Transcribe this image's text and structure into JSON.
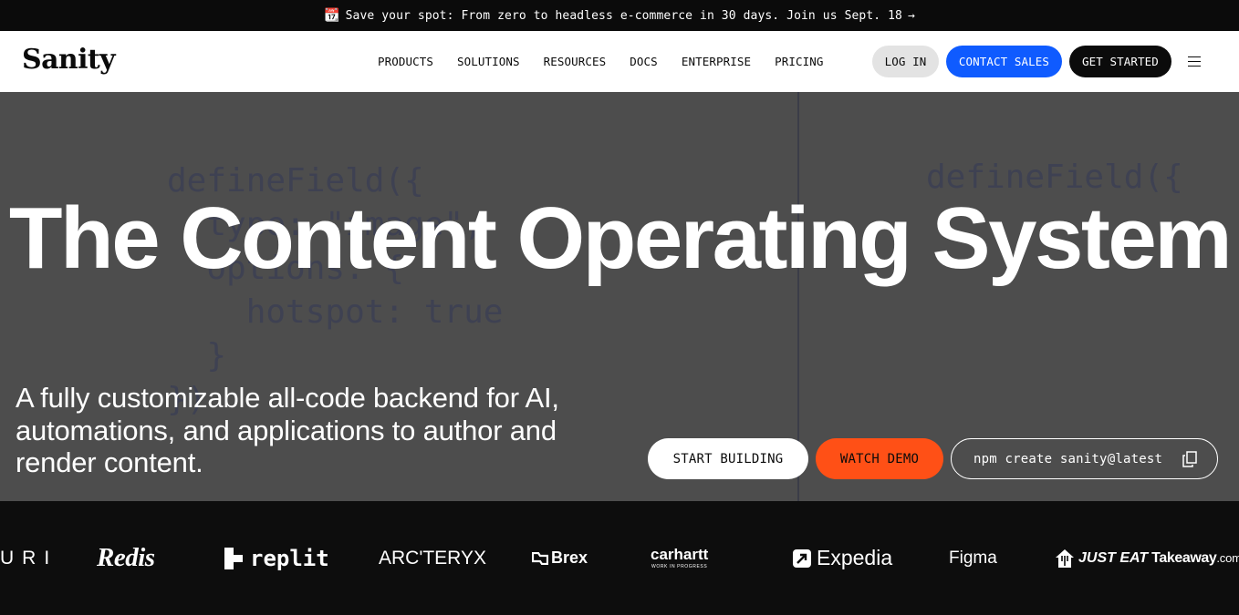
{
  "announcement": {
    "icon": "calendar-icon",
    "text": "Save your spot: From zero to headless e-commerce in 30 days. Join us Sept. 18",
    "arrow": "→"
  },
  "header": {
    "logo": "Sanity",
    "nav": [
      "PRODUCTS",
      "SOLUTIONS",
      "RESOURCES",
      "DOCS",
      "ENTERPRISE",
      "PRICING"
    ],
    "login_label": "LOG IN",
    "contact_label": "CONTACT SALES",
    "get_started_label": "GET STARTED",
    "menu_icon": "hamburger-menu-icon"
  },
  "hero": {
    "code_left": "defineField({\n  type: \"image\",\n  options: {\n    hotspot: true\n  }\n})",
    "code_right": "defineField({",
    "headline": "The Content Operating System",
    "subtitle": "A fully customizable all-code backend for AI, automations, and applications to author and render content.",
    "start_building_label": "START BUILDING",
    "watch_demo_label": "WATCH DEMO",
    "npm_command": "npm create sanity@latest",
    "copy_icon": "copy-icon"
  },
  "logos": [
    {
      "name": "URI"
    },
    {
      "name": "Redis"
    },
    {
      "name": "replit"
    },
    {
      "name": "ARC'TERYX"
    },
    {
      "name": "Brex"
    },
    {
      "name": "carhartt",
      "sub": "WORK IN PROGRESS"
    },
    {
      "name": "Expedia"
    },
    {
      "name": "Figma"
    },
    {
      "name": "JUST EAT",
      "name2": "Takeaway",
      "suffix": ".com"
    }
  ],
  "colors": {
    "hero_bg": "#4d4d4d",
    "contact_blue": "#0f5bff",
    "demo_orange": "#ff5016",
    "dark": "#0b0b0b",
    "code_text": "#3e4152"
  }
}
